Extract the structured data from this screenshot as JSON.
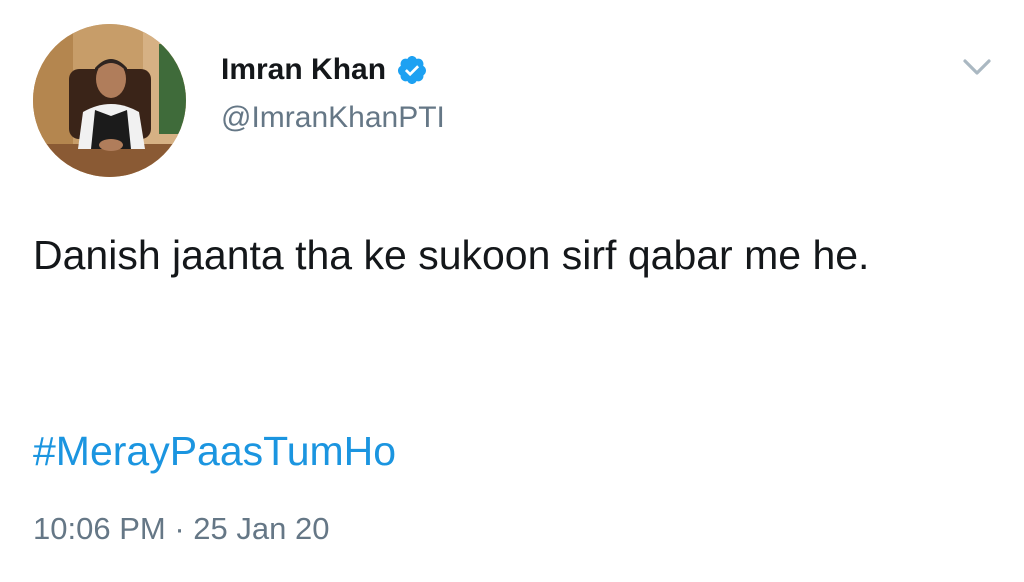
{
  "tweet": {
    "author": {
      "name": "Imran Khan",
      "handle": "@ImranKhanPTI",
      "verified": true
    },
    "text": "Danish jaanta tha ke sukoon sirf qabar me he.",
    "hashtag": "#MerayPaasTumHo",
    "time": "10:06 PM",
    "separator": " · ",
    "date": "25 Jan 20"
  },
  "icons": {
    "verified": "verified-badge-icon",
    "menu": "chevron-down-icon"
  },
  "colors": {
    "text": "#14171a",
    "secondary": "#657786",
    "link": "#1b95e0",
    "verified": "#1da1f2"
  }
}
